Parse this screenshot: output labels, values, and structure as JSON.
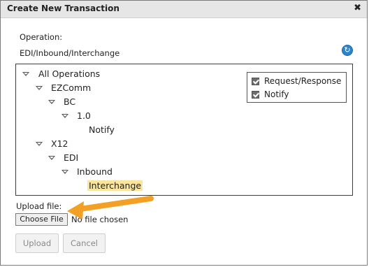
{
  "dialog": {
    "title": "Create New Transaction",
    "close_icon": "close-icon"
  },
  "operation": {
    "label": "Operation:",
    "path": "EDI/Inbound/Interchange",
    "refresh_icon": "refresh-icon"
  },
  "tree": {
    "nodes": [
      {
        "label": "All Operations",
        "expanded": true
      },
      {
        "label": "EZComm",
        "expanded": true
      },
      {
        "label": "BC",
        "expanded": true
      },
      {
        "label": "1.0",
        "expanded": true
      },
      {
        "label": "Notify",
        "leaf": true
      },
      {
        "label": "X12",
        "expanded": true
      },
      {
        "label": "EDI",
        "expanded": true
      },
      {
        "label": "Inbound",
        "expanded": true
      },
      {
        "label": "Interchange",
        "leaf": true,
        "selected": true
      }
    ]
  },
  "filters": [
    {
      "label": "Request/Response",
      "checked": true
    },
    {
      "label": "Notify",
      "checked": true
    }
  ],
  "upload": {
    "label": "Upload file:",
    "choose_button": "Choose File",
    "no_file_text": "No file chosen"
  },
  "actions": {
    "upload_label": "Upload",
    "cancel_label": "Cancel"
  },
  "colors": {
    "selection_highlight": "#fbe49b",
    "annotation_arrow": "#f2a126",
    "refresh_icon": "#2b86c9"
  }
}
